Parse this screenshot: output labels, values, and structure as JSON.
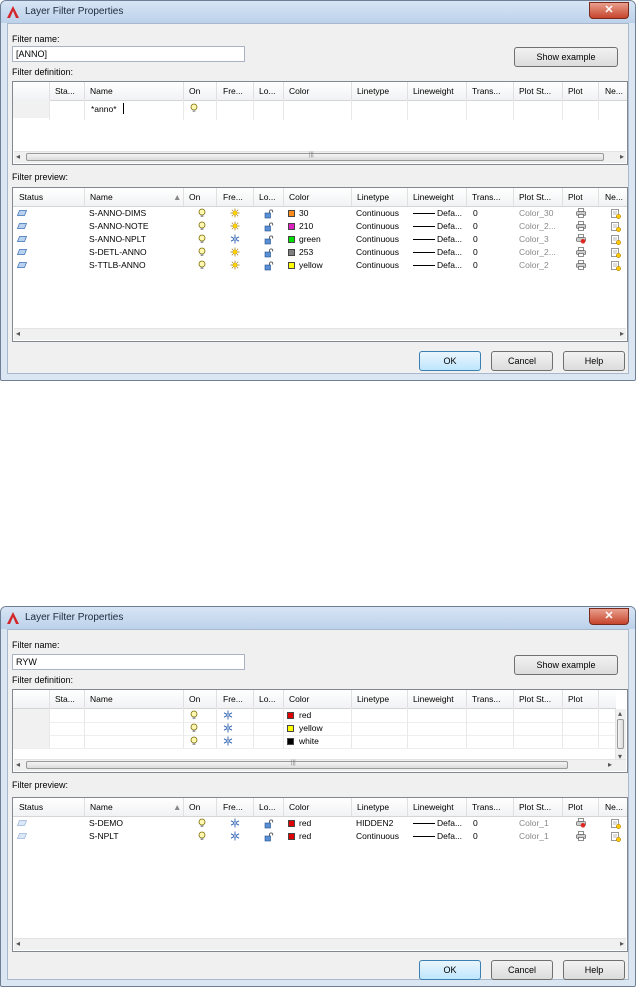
{
  "dialogs": [
    {
      "title": "Layer Filter Properties",
      "close_label": "✕",
      "filter_name_label": "Filter name:",
      "filter_name_value": "[ANNO]",
      "show_example_label": "Show example",
      "filter_definition_label": "Filter definition:",
      "definition_columns": [
        "Sta...",
        "Name",
        "On",
        "Fre...",
        "Lo...",
        "Color",
        "Linetype",
        "Lineweight",
        "Trans...",
        "Plot St...",
        "Plot",
        "Ne..."
      ],
      "definition_rows": [
        {
          "name": "*anno*",
          "on": "bulb",
          "color": ""
        }
      ],
      "filter_preview_label": "Filter preview:",
      "preview_columns": [
        "Status",
        "Name",
        "On",
        "Fre...",
        "Lo...",
        "Color",
        "Linetype",
        "Lineweight",
        "Trans...",
        "Plot St...",
        "Plot",
        "Ne..."
      ],
      "preview_rows": [
        {
          "name": "S-ANNO-DIMS",
          "freeze": "sun",
          "color_name": "30",
          "color_hex": "#ff8c1a",
          "linetype": "Continuous",
          "lineweight": "Defa...",
          "trans": "0",
          "plot_style": "Color_30",
          "plot": "printer"
        },
        {
          "name": "S-ANNO-NOTE",
          "freeze": "sun",
          "color_name": "210",
          "color_hex": "#e020c0",
          "linetype": "Continuous",
          "lineweight": "Defa...",
          "trans": "0",
          "plot_style": "Color_2...",
          "plot": "printer"
        },
        {
          "name": "S-ANNO-NPLT",
          "freeze": "snow",
          "color_name": "green",
          "color_hex": "#00e000",
          "linetype": "Continuous",
          "lineweight": "Defa...",
          "trans": "0",
          "plot_style": "Color_3",
          "plot": "noplot"
        },
        {
          "name": "S-DETL-ANNO",
          "freeze": "sun",
          "color_name": "253",
          "color_hex": "#808080",
          "linetype": "Continuous",
          "lineweight": "Defa...",
          "trans": "0",
          "plot_style": "Color_2...",
          "plot": "printer"
        },
        {
          "name": "S-TTLB-ANNO",
          "freeze": "sun",
          "color_name": "yellow",
          "color_hex": "#ffff00",
          "linetype": "Continuous",
          "lineweight": "Defa...",
          "trans": "0",
          "plot_style": "Color_2",
          "plot": "printer"
        }
      ],
      "ok_label": "OK",
      "cancel_label": "Cancel",
      "help_label": "Help"
    },
    {
      "title": "Layer Filter Properties",
      "close_label": "✕",
      "filter_name_label": "Filter name:",
      "filter_name_value": "RYW",
      "show_example_label": "Show example",
      "filter_definition_label": "Filter definition:",
      "definition_columns": [
        "Sta...",
        "Name",
        "On",
        "Fre...",
        "Lo...",
        "Color",
        "Linetype",
        "Lineweight",
        "Trans...",
        "Plot St...",
        "Plot"
      ],
      "definition_rows": [
        {
          "name": "",
          "color_name": "red",
          "color_hex": "#e00000"
        },
        {
          "name": "",
          "color_name": "yellow",
          "color_hex": "#ffff00"
        },
        {
          "name": "",
          "color_name": "white",
          "color_hex": "#000000"
        }
      ],
      "filter_preview_label": "Filter preview:",
      "preview_columns": [
        "Status",
        "Name",
        "On",
        "Fre...",
        "Lo...",
        "Color",
        "Linetype",
        "Lineweight",
        "Trans...",
        "Plot St...",
        "Plot",
        "Ne..."
      ],
      "preview_rows": [
        {
          "name": "S-DEMO",
          "freeze": "snow",
          "color_name": "red",
          "color_hex": "#e00000",
          "linetype": "HIDDEN2",
          "lineweight": "Defa...",
          "trans": "0",
          "plot_style": "Color_1",
          "plot": "noplot"
        },
        {
          "name": "S-NPLT",
          "freeze": "snow",
          "color_name": "red",
          "color_hex": "#e00000",
          "linetype": "Continuous",
          "lineweight": "Defa...",
          "trans": "0",
          "plot_style": "Color_1",
          "plot": "printer"
        }
      ],
      "ok_label": "OK",
      "cancel_label": "Cancel",
      "help_label": "Help"
    }
  ],
  "sort_indicator": "▲",
  "scroll_left": "◂",
  "scroll_right": "▸",
  "scroll_up": "▴",
  "scroll_down": "▾",
  "thumb_grip": "|||",
  "icons": {
    "on": "lightbulb-icon",
    "sun": "sun-icon",
    "snow": "snowflake-icon",
    "lock": "unlocked-padlock-icon",
    "printer": "printer-icon",
    "noplot": "no-plot-printer-icon",
    "newvp": "new-viewport-freeze-icon",
    "status": "layer-status-icon"
  }
}
